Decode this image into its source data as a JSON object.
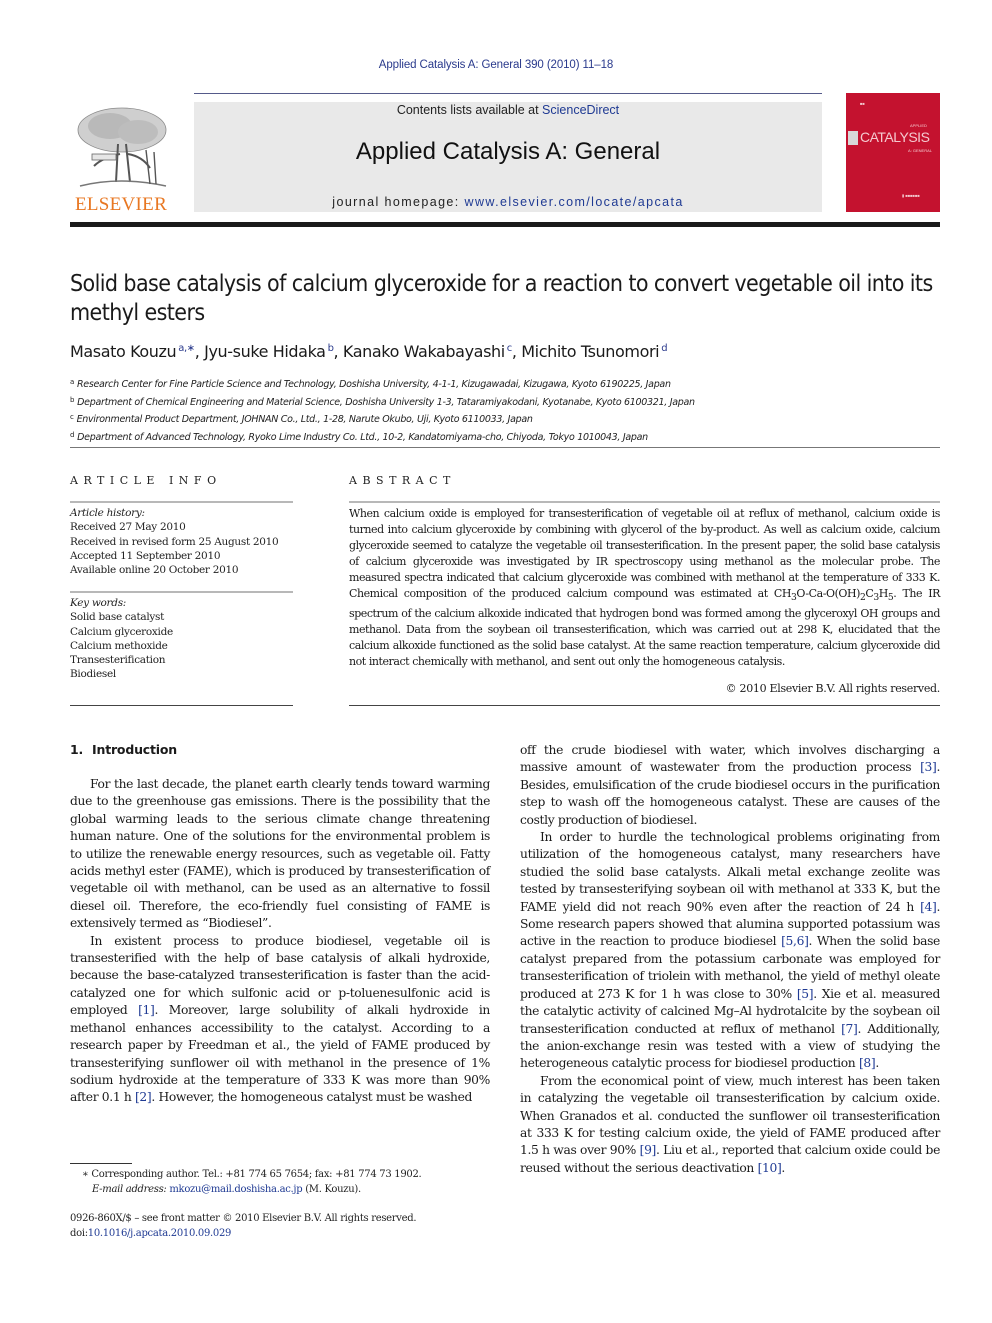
{
  "header": {
    "journal_reference": "Applied Catalysis A: General 390 (2010) 11–18",
    "contents_prefix": "Contents lists available at ",
    "contents_link": "ScienceDirect",
    "journal_name": "Applied Catalysis A: General",
    "homepage_prefix": "journal homepage: ",
    "homepage_url": "www.elsevier.com/locate/apcata",
    "publisher_logo_text": "ELSEVIER",
    "cover_title": "CATALYSIS",
    "cover_subtitle_top": "APPLIED",
    "cover_subtitle_bottom": "A: GENERAL",
    "colors": {
      "link": "#1f3a93",
      "elsevier_orange": "#e87722",
      "cover_red": "#c4122f",
      "header_gray": "#e9e9e9"
    }
  },
  "article": {
    "title": "Solid base catalysis of calcium glyceroxide for a reaction to convert vegetable oil into its methyl esters",
    "authors": [
      {
        "name": "Masato Kouzu",
        "affil": "a,∗"
      },
      {
        "name": "Jyu-suke Hidaka",
        "affil": "b"
      },
      {
        "name": "Kanako Wakabayashi",
        "affil": "c"
      },
      {
        "name": "Michito Tsunomori",
        "affil": "d"
      }
    ],
    "affiliations": [
      {
        "mark": "a",
        "text": "Research Center for Fine Particle Science and Technology, Doshisha University, 4-1-1, Kizugawadai, Kizugawa, Kyoto 6190225, Japan"
      },
      {
        "mark": "b",
        "text": "Department of Chemical Engineering and Material Science, Doshisha University 1-3, Tataramiyakodani, Kyotanabe, Kyoto 6100321, Japan"
      },
      {
        "mark": "c",
        "text": "Environmental Product Department, JOHNAN Co., Ltd., 1-28, Narute Okubo, Uji, Kyoto 6110033, Japan"
      },
      {
        "mark": "d",
        "text": "Department of Advanced Technology, Ryoko Lime Industry Co. Ltd., 10-2, Kandatomiyama-cho, Chiyoda, Tokyo 1010043, Japan"
      }
    ]
  },
  "article_info": {
    "label": "ARTICLE INFO",
    "history_label": "Article history:",
    "history": [
      "Received 27 May 2010",
      "Received in revised form 25 August 2010",
      "Accepted 11 September 2010",
      "Available online 20 October 2010"
    ],
    "keywords_label": "Key words:",
    "keywords": [
      "Solid base catalyst",
      "Calcium glyceroxide",
      "Calcium methoxide",
      "Transesterification",
      "Biodiesel"
    ]
  },
  "abstract": {
    "label": "ABSTRACT",
    "text_part1": "When calcium oxide is employed for transesterification of vegetable oil at reflux of methanol, calcium oxide is turned into calcium glyceroxide by combining with glycerol of the by-product. As well as calcium oxide, calcium glyceroxide seemed to catalyze the vegetable oil transesterification. In the present paper, the solid base catalysis of calcium glyceroxide was investigated by IR spectroscopy using methanol as the molecular probe. The measured spectra indicated that calcium glyceroxide was combined with methanol at the temperature of 333 K. Chemical composition of the produced calcium compound was estimated at CH",
    "formula_parts": [
      "3",
      "O-Ca-O(OH)",
      "2",
      "C",
      "3",
      "H",
      "5"
    ],
    "text_part2": ". The IR spectrum of the calcium alkoxide indicated that hydrogen bond was formed among the glyceroxyl OH groups and methanol. Data from the soybean oil transesterification, which was carried out at 298 K, elucidated that the calcium alkoxide functioned as the solid base catalyst. At the same reaction temperature, calcium glyceroxide did not interact chemically with methanol, and sent out only the homogeneous catalysis.",
    "copyright": "© 2010 Elsevier B.V. All rights reserved."
  },
  "introduction": {
    "number": "1.",
    "heading": "Introduction",
    "left_column": [
      {
        "segments": [
          "For the last decade, the planet earth clearly tends toward warming due to the greenhouse gas emissions. There is the possibility that the global warming leads to the serious climate change threatening human nature. One of the solutions for the environmental problem is to utilize the renewable energy resources, such as vegetable oil. Fatty acids methyl ester (FAME), which is produced by transesterification of vegetable oil with methanol, can be used as an alternative to fossil diesel oil. Therefore, the eco-friendly fuel consisting of FAME is extensively termed as “Biodiesel”."
        ]
      },
      {
        "p2a": "In existent process to produce biodiesel, vegetable oil is transesterified with the help of base catalysis of alkali hydroxide, because the base-catalyzed transesterification is faster than the acid-catalyzed one for which sulfonic acid or p-toluenesulfonic acid is employed ",
        "c1": "[1]",
        "p2b": ". Moreover, large solubility of alkali hydroxide in methanol enhances accessibility to the catalyst. According to a research paper by Freedman et al., the yield of FAME produced by transesterifying sunflower oil with methanol in the presence of 1% sodium hydroxide at the temperature of 333 K was more than 90% after 0.1 h ",
        "c2": "[2]",
        "p2c": ". However, the homogeneous catalyst must be washed"
      }
    ],
    "right_column": {
      "p1a": "off the crude biodiesel with water, which involves discharging a massive amount of wastewater from the production process ",
      "c3": "[3]",
      "p1b": ". Besides, emulsification of the crude biodiesel occurs in the purification step to wash off the homogeneous catalyst. These are causes of the costly production of biodiesel.",
      "p2a": "In order to hurdle the technological problems originating from utilization of the homogeneous catalyst, many researchers have studied the solid base catalysts. Alkali metal exchange zeolite was tested by transesterifying soybean oil with methanol at 333 K, but the FAME yield did not reach 90% even after the reaction of 24 h ",
      "c4": "[4]",
      "p2b": ". Some research papers showed that alumina supported potassium was active in the reaction to produce biodiesel ",
      "c56": "[5,6]",
      "p2c": ". When the solid base catalyst prepared from the potassium carbonate was employed for transesterification of triolein with methanol, the yield of methyl oleate produced at 273 K for 1 h was close to 30% ",
      "c5": "[5]",
      "p2d": ". Xie et al. measured the catalytic activity of calcined Mg–Al hydrotalcite by the soybean oil transesterification conducted at reflux of methanol ",
      "c7": "[7]",
      "p2e": ". Additionally, the anion-exchange resin was tested with a view of studying the heterogeneous catalytic process for biodiesel production ",
      "c8": "[8]",
      "p2f": ".",
      "p3a": "From the economical point of view, much interest has been taken in catalyzing the vegetable oil transesterification by calcium oxide. When Granados et al. conducted the sunflower oil transesterification at 333 K for testing calcium oxide, the yield of FAME produced after 1.5 h was over 90% ",
      "c9": "[9]",
      "p3b": ". Liu et al., reported that calcium oxide could be reused without the serious deactivation ",
      "c10": "[10]",
      "p3c": "."
    }
  },
  "footnotes": {
    "marker": "∗",
    "corresponding": "Corresponding author. Tel.: +81 774 65 7654; fax: +81 774 73 1902.",
    "email_label": "E-mail address:",
    "email": "mkozu@mail.doshisha.ac.jp",
    "email_suffix": " (M. Kouzu).",
    "front_matter": "0926-860X/$ – see front matter © 2010 Elsevier B.V. All rights reserved.",
    "doi_prefix": "doi:",
    "doi": "10.1016/j.apcata.2010.09.029"
  }
}
